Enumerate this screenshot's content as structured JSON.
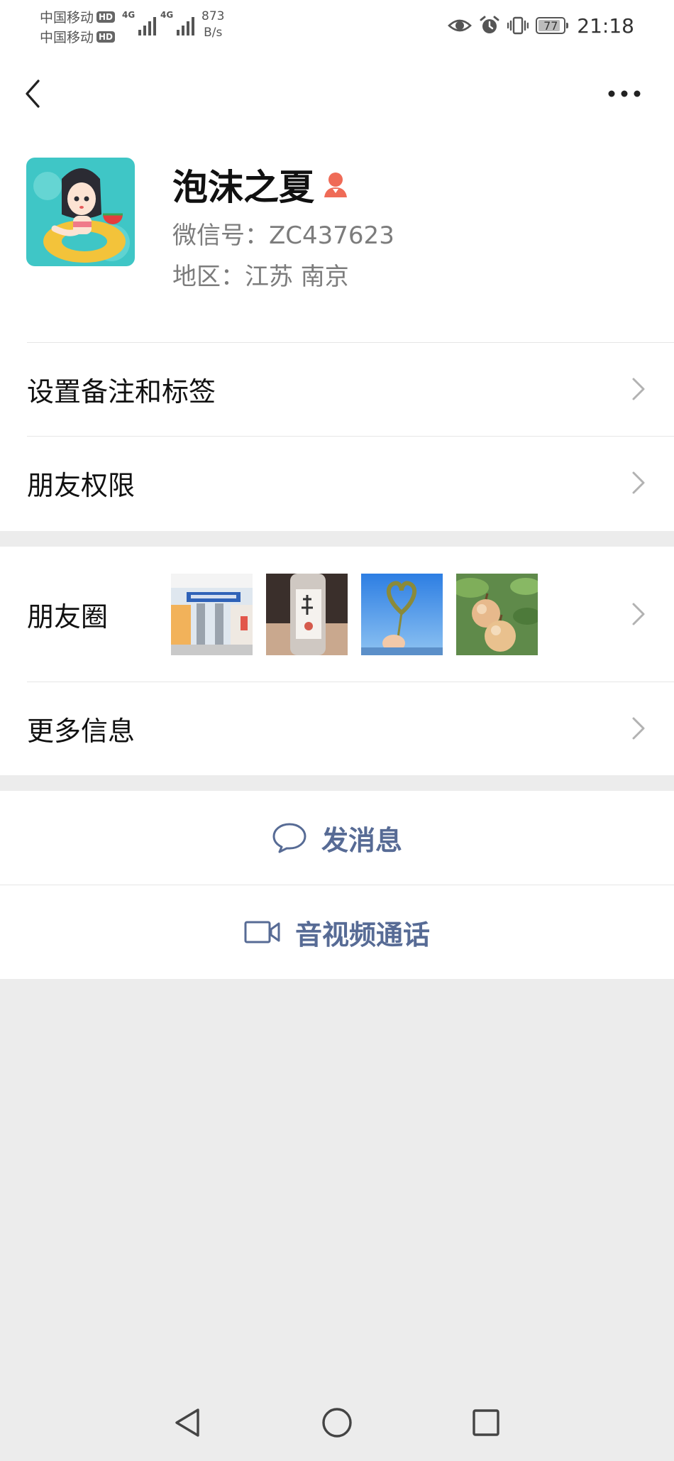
{
  "status_bar": {
    "carrier1": "中国移动",
    "carrier2": "中国移动",
    "hd_badge": "HD",
    "network1": "4G",
    "network2": "4G",
    "net_speed_value": "873",
    "net_speed_unit": "B/s",
    "battery_level": "77",
    "time": "21:18",
    "icons": [
      "eye-icon",
      "alarm-icon",
      "vibrate-icon",
      "battery-icon"
    ]
  },
  "header": {
    "back_icon": "chevron-left-icon",
    "more_icon": "more-dots-icon"
  },
  "profile": {
    "nickname": "泡沫之夏",
    "gender_icon": "female-icon",
    "wechat_id": "微信号：ZC437623",
    "region": "地区：江苏  南京"
  },
  "settings": {
    "remark_label": "设置备注和标签",
    "permission_label": "朋友权限"
  },
  "moments": {
    "label": "朋友圈",
    "photos": [
      "moments-photo-1",
      "moments-photo-2",
      "moments-photo-3",
      "moments-photo-4"
    ]
  },
  "more_info": {
    "label": "更多信息"
  },
  "actions": {
    "message_label": "发消息",
    "call_label": "音视频通话"
  },
  "colors": {
    "link_blue": "#576b95",
    "background": "#ececec",
    "female_icon": "#ef6b57"
  }
}
